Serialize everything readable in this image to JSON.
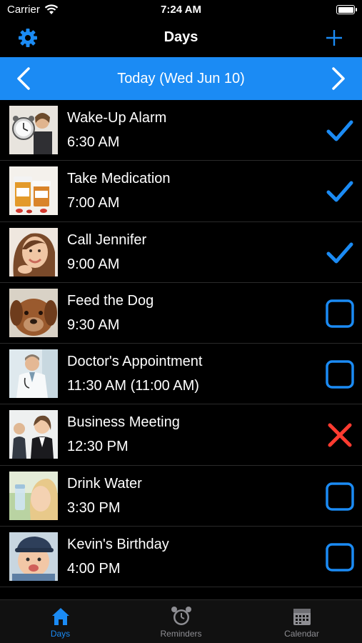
{
  "status_bar": {
    "carrier": "Carrier",
    "time": "7:24 AM"
  },
  "navbar": {
    "title": "Days"
  },
  "date_bar": {
    "label": "Today (Wed Jun 10)"
  },
  "colors": {
    "accent": "#1b8bf4",
    "cancel": "#ff3b30",
    "background": "#000000"
  },
  "items": [
    {
      "name": "Wake-Up Alarm",
      "time": "6:30 AM",
      "status": "done",
      "photo": "woman-with-clock"
    },
    {
      "name": "Take Medication",
      "time": "7:00 AM",
      "status": "done",
      "photo": "pill-bottles"
    },
    {
      "name": "Call Jennifer",
      "time": "9:00 AM",
      "status": "done",
      "photo": "smiling-woman"
    },
    {
      "name": "Feed the Dog",
      "time": "9:30 AM",
      "status": "pending",
      "photo": "dog"
    },
    {
      "name": "Doctor's Appointment",
      "time": "11:30 AM (11:00 AM)",
      "status": "pending",
      "photo": "doctor"
    },
    {
      "name": "Business Meeting",
      "time": "12:30 PM",
      "status": "cancelled",
      "photo": "business-people"
    },
    {
      "name": "Drink Water",
      "time": "3:30 PM",
      "status": "pending",
      "photo": "woman-drinking"
    },
    {
      "name": "Kevin's Birthday",
      "time": "4:00 PM",
      "status": "pending",
      "photo": "baby"
    }
  ],
  "tabs": [
    {
      "label": "Days",
      "icon": "house-icon",
      "active": true
    },
    {
      "label": "Reminders",
      "icon": "alarm-clock-icon",
      "active": false
    },
    {
      "label": "Calendar",
      "icon": "calendar-icon",
      "active": false
    }
  ]
}
